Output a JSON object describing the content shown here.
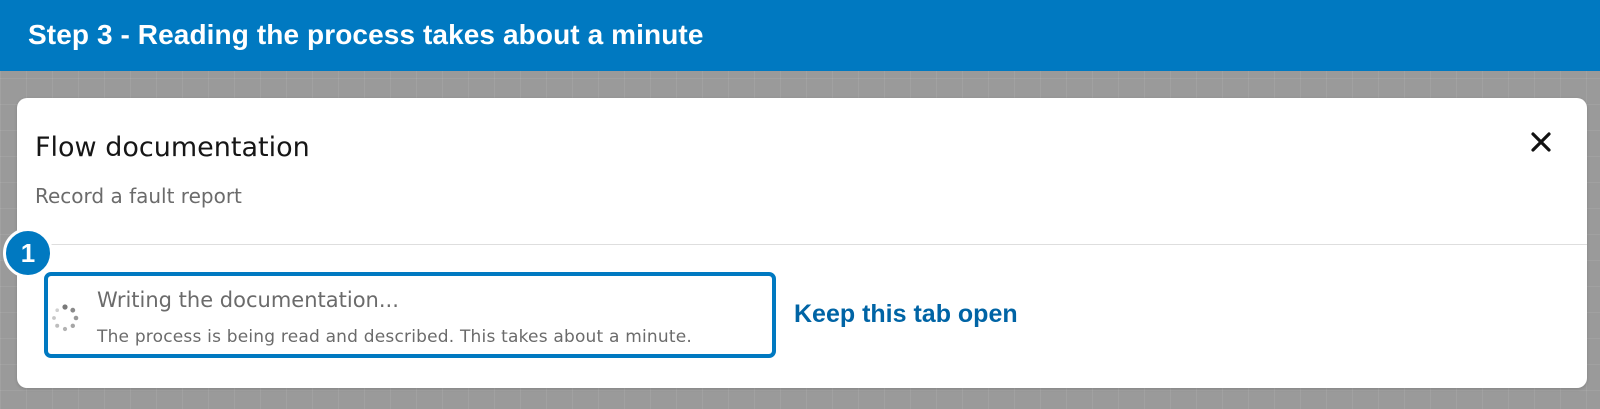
{
  "banner": {
    "text": "Step 3 - Reading the process takes about a minute"
  },
  "modal": {
    "title": "Flow documentation",
    "subtitle": "Record a fault report",
    "close_icon": "close-icon"
  },
  "status": {
    "icon": "loading-spinner-icon",
    "title": "Writing the documentation...",
    "description": "The process is being read and described. This takes about a minute."
  },
  "hint": {
    "text": "Keep this tab open"
  },
  "marker": {
    "number": "1"
  },
  "colors": {
    "accent": "#0079c1",
    "hint_text": "#0064a5",
    "muted_text": "#6b6b6b",
    "backdrop": "#9a9a9a"
  }
}
